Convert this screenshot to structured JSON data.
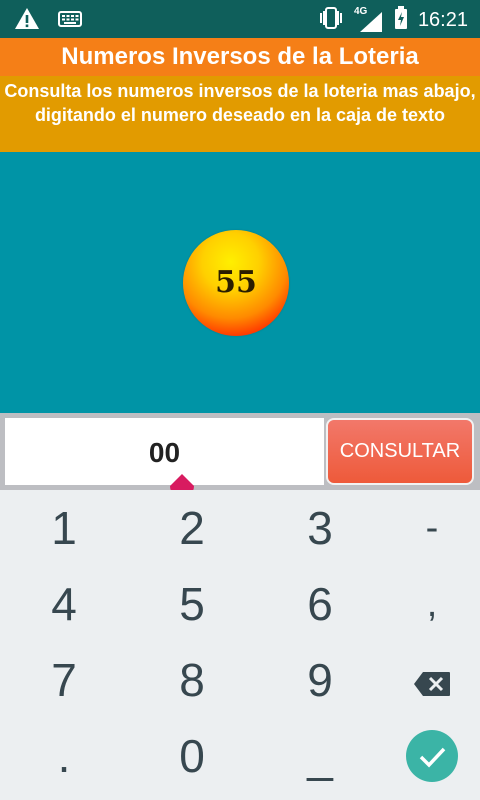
{
  "status_bar": {
    "time": "16:21",
    "network": "4G",
    "icons": [
      "warning-icon",
      "keyboard-icon",
      "vibrate-icon",
      "signal-icon",
      "battery-charging-icon"
    ]
  },
  "header": {
    "title": "Numeros Inversos de la Loteria",
    "subtitle": "Consulta los numeros inversos de la loteria mas abajo, digitando el numero deseado en la caja de texto"
  },
  "ball": {
    "number": "55"
  },
  "input": {
    "value": "00"
  },
  "button": {
    "label": "CONSULTAR"
  },
  "keypad": {
    "keys": [
      [
        "1",
        "2",
        "3",
        "-"
      ],
      [
        "4",
        "5",
        "6",
        ","
      ],
      [
        "7",
        "8",
        "9",
        "backspace-icon"
      ],
      [
        ".",
        "0",
        "_",
        "done-icon"
      ]
    ]
  },
  "colors": {
    "status_bar": "#0f5f5b",
    "title_bar": "#f57f17",
    "subtitle_bar": "#e29b00",
    "main_background": "#0094a6",
    "button": "#ee5a3a",
    "cursor_handle": "#d81b60",
    "done_button": "#3bb4a6"
  }
}
